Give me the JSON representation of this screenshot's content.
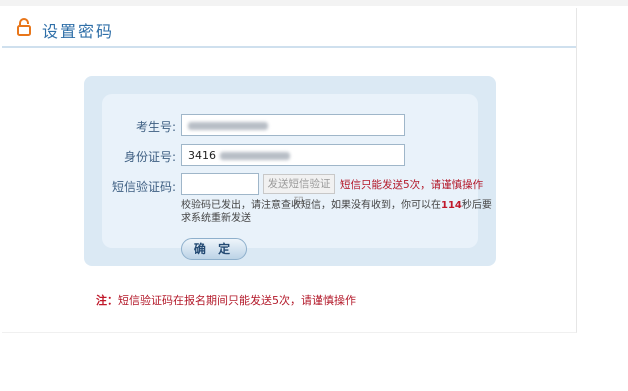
{
  "header": {
    "title": "设置密码",
    "icon": "lock-icon"
  },
  "form": {
    "exam_id_label": "考生号:",
    "exam_id_value": "",
    "id_card_label": "身份证号:",
    "id_card_value": "3416",
    "sms_label": "短信验证码:",
    "sms_value": "",
    "send_sms_button": "发送短信验证码",
    "sms_limit_warning": "短信只能发送5次，请谨慎操作",
    "hint_prefix": "校验码已发出，请注意查收短信，如果没有收到，你可以在",
    "countdown": "114",
    "hint_suffix": "秒后要求系统重新发送",
    "confirm_button": "确 定"
  },
  "footer_note": {
    "label": "注：",
    "text": "短信验证码在报名期间只能发送5次，请谨慎操作"
  },
  "colors": {
    "title": "#2f6fa8",
    "warning": "#b3192a",
    "panel": "#dbe9f4",
    "icon": "#e8761a"
  }
}
